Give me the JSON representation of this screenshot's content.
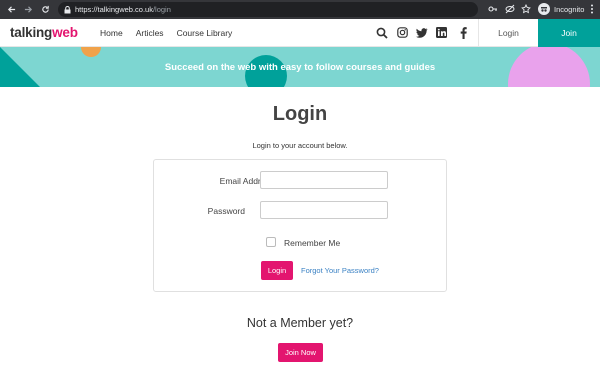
{
  "browser": {
    "url_host": "https://talkingweb.co.uk",
    "url_path": "/login",
    "incognito_label": "Incognito"
  },
  "header": {
    "logo_part1": "talking",
    "logo_part2": "web",
    "nav": [
      "Home",
      "Articles",
      "Course Library"
    ],
    "social_icons": [
      "search-icon",
      "instagram-icon",
      "twitter-icon",
      "linkedin-icon",
      "facebook-icon"
    ],
    "login_label": "Login",
    "join_label": "Join"
  },
  "banner": {
    "tagline": "Succeed on the web with easy to follow courses and guides"
  },
  "main": {
    "title": "Login",
    "subtitle": "Login to your account below.",
    "email_label": "Email Address",
    "email_value": "",
    "password_label": "Password",
    "password_value": "",
    "remember_label": "Remember Me",
    "login_button": "Login",
    "forgot_link": "Forgot Your Password?",
    "not_member": "Not a Member yet?",
    "join_button": "Join Now"
  },
  "colors": {
    "brand_pink": "#e3156f",
    "brand_teal": "#00a19a",
    "banner_bg": "#7dd6d1"
  }
}
